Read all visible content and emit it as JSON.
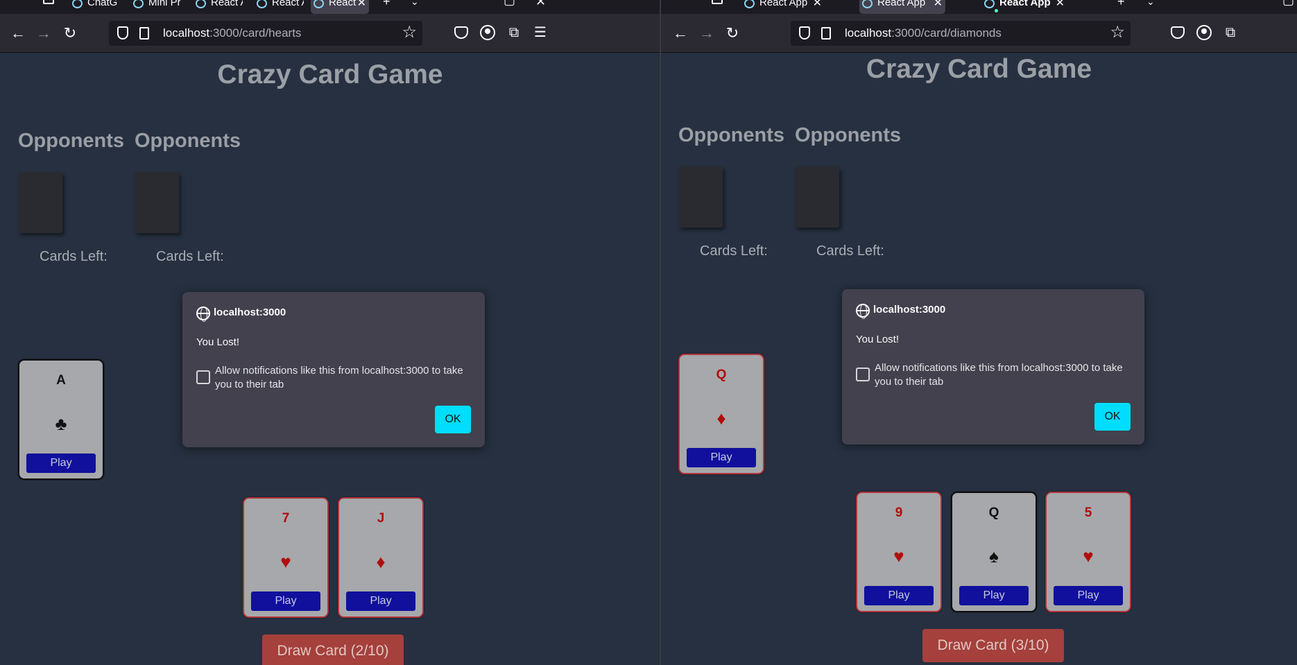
{
  "left": {
    "tabs": [
      "ChatGPT",
      "Mini Pr",
      "React Ap",
      "React Ap",
      "React"
    ],
    "url": {
      "host": "localhost",
      "path": ":3000/card/hearts"
    },
    "title": "Crazy Card Game",
    "opponents": [
      {
        "heading": "Opponents",
        "cards_left": "Cards Left:"
      },
      {
        "heading": "Opponents",
        "cards_left": "Cards Left:"
      }
    ],
    "pile_card": {
      "rank": "A",
      "suit": "♣",
      "color": "black",
      "play": "Play"
    },
    "hand": [
      {
        "rank": "7",
        "suit": "♥",
        "color": "red",
        "play": "Play"
      },
      {
        "rank": "J",
        "suit": "♦",
        "color": "red",
        "play": "Play"
      }
    ],
    "draw_button": "Draw Card (2/10)",
    "dialog": {
      "origin": "localhost:3000",
      "message": "You Lost!",
      "checkbox_label": "Allow notifications like this from localhost:3000 to take you to their tab",
      "ok": "OK"
    }
  },
  "right": {
    "tabs": [
      "React App",
      "React App",
      "React App"
    ],
    "url": {
      "host": "localhost",
      "path": ":3000/card/diamonds"
    },
    "title": "Crazy Card Game",
    "opponents": [
      {
        "heading": "Opponents",
        "cards_left": "Cards Left:"
      },
      {
        "heading": "Opponents",
        "cards_left": "Cards Left:"
      }
    ],
    "pile_card": {
      "rank": "Q",
      "suit": "♦",
      "color": "red",
      "play": "Play"
    },
    "hand": [
      {
        "rank": "9",
        "suit": "♥",
        "color": "red",
        "play": "Play"
      },
      {
        "rank": "Q",
        "suit": "♠",
        "color": "black",
        "play": "Play"
      },
      {
        "rank": "5",
        "suit": "♥",
        "color": "red",
        "play": "Play"
      }
    ],
    "draw_button": "Draw Card (3/10)",
    "dialog": {
      "origin": "localhost:3000",
      "message": "You Lost!",
      "checkbox_label": "Allow notifications like this from localhost:3000 to take you to their tab",
      "ok": "OK"
    }
  },
  "icons": {
    "back": "back-arrow-icon",
    "forward": "forward-arrow-icon",
    "reload": "reload-icon",
    "shield": "tracking-protection-shield-icon",
    "page": "page-icon",
    "bookmark": "bookmark-star-icon",
    "pocket": "pocket-icon",
    "account": "account-icon",
    "extensions": "extensions-puzzle-icon",
    "menu": "hamburger-menu-icon",
    "globe": "globe-icon"
  },
  "colors": {
    "page_bg": "#263040",
    "dialog_bg": "#42414d",
    "ok_button": "#00ddff",
    "play_button": "#10109c",
    "draw_button": "#a5403c",
    "red_suit": "#b10d0d"
  }
}
